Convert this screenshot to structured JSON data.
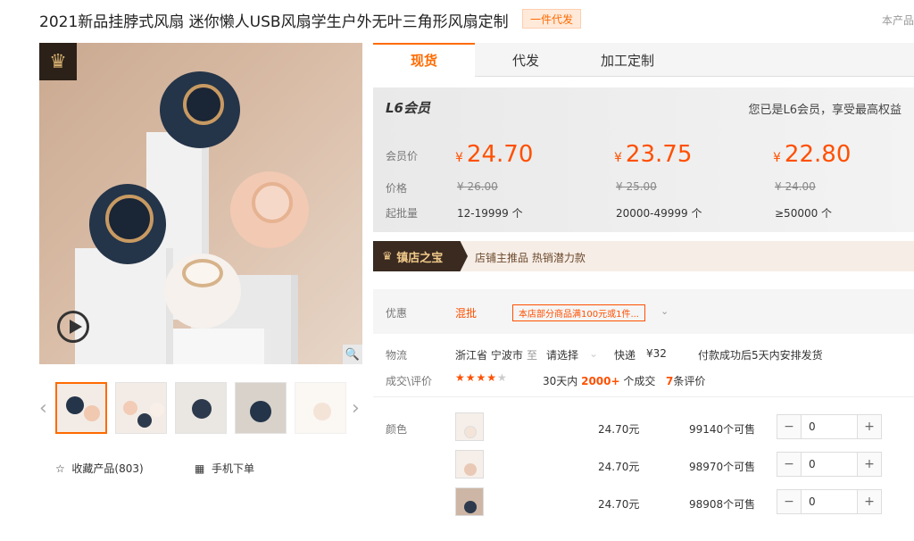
{
  "header": {
    "title": "2021新品挂脖式风扇 迷你懒人USB风扇学生户外无叶三角形风扇定制",
    "badge": "一件代发",
    "top_right": "本产品"
  },
  "gallery": {
    "crown_icon": "crown-icon",
    "play_icon": "play-icon",
    "zoom_icon": "magnifier-icon",
    "thumbs_count": 5
  },
  "actions": {
    "collect": "收藏产品(803)",
    "mobile": "手机下单"
  },
  "tabs": [
    "现货",
    "代发",
    "加工定制"
  ],
  "price_box": {
    "member_level": "L6会员",
    "member_note": "您已是L6会员，享受最高权益",
    "labels": {
      "member_price": "会员价",
      "price": "价格",
      "moq": "起批量"
    },
    "currency": "¥",
    "tiers": [
      {
        "member_price": "24.70",
        "orig": "¥ 26.00",
        "qty": "12-19999 个"
      },
      {
        "member_price": "23.75",
        "orig": "¥ 25.00",
        "qty": "20000-49999 个"
      },
      {
        "member_price": "22.80",
        "orig": "¥ 24.00",
        "qty": "≥50000 个"
      }
    ]
  },
  "treasure": {
    "tag": "镇店之宝",
    "text": "店铺主推品  热销潜力款"
  },
  "discount": {
    "label": "优惠",
    "mix": "混批",
    "coupon": "本店部分商品满100元或1件...",
    "arrow": "⌄"
  },
  "logistics": {
    "label": "物流",
    "from": "浙江省 宁波市",
    "to_word": "至",
    "to": "请选择",
    "express": "快递",
    "fee": "¥32",
    "ship_note": "付款成功后5天内安排发货"
  },
  "deals": {
    "label": "成交\\评价",
    "stars": "★★★★",
    "star_off": "★",
    "days": "30天内",
    "count": "2000+",
    "count_suffix": "个成交",
    "reviews": "7",
    "reviews_suffix": "条评价"
  },
  "sku": {
    "label": "颜色",
    "items": [
      {
        "price": "24.70元",
        "stock": "99140个可售",
        "qty": "0",
        "color": "#f4e4d8"
      },
      {
        "price": "24.70元",
        "stock": "98970个可售",
        "qty": "0",
        "color": "#e9c9b5"
      },
      {
        "price": "24.70元",
        "stock": "98908个可售",
        "qty": "0",
        "color": "#2d3a4d"
      }
    ],
    "minus": "−",
    "plus": "+"
  }
}
